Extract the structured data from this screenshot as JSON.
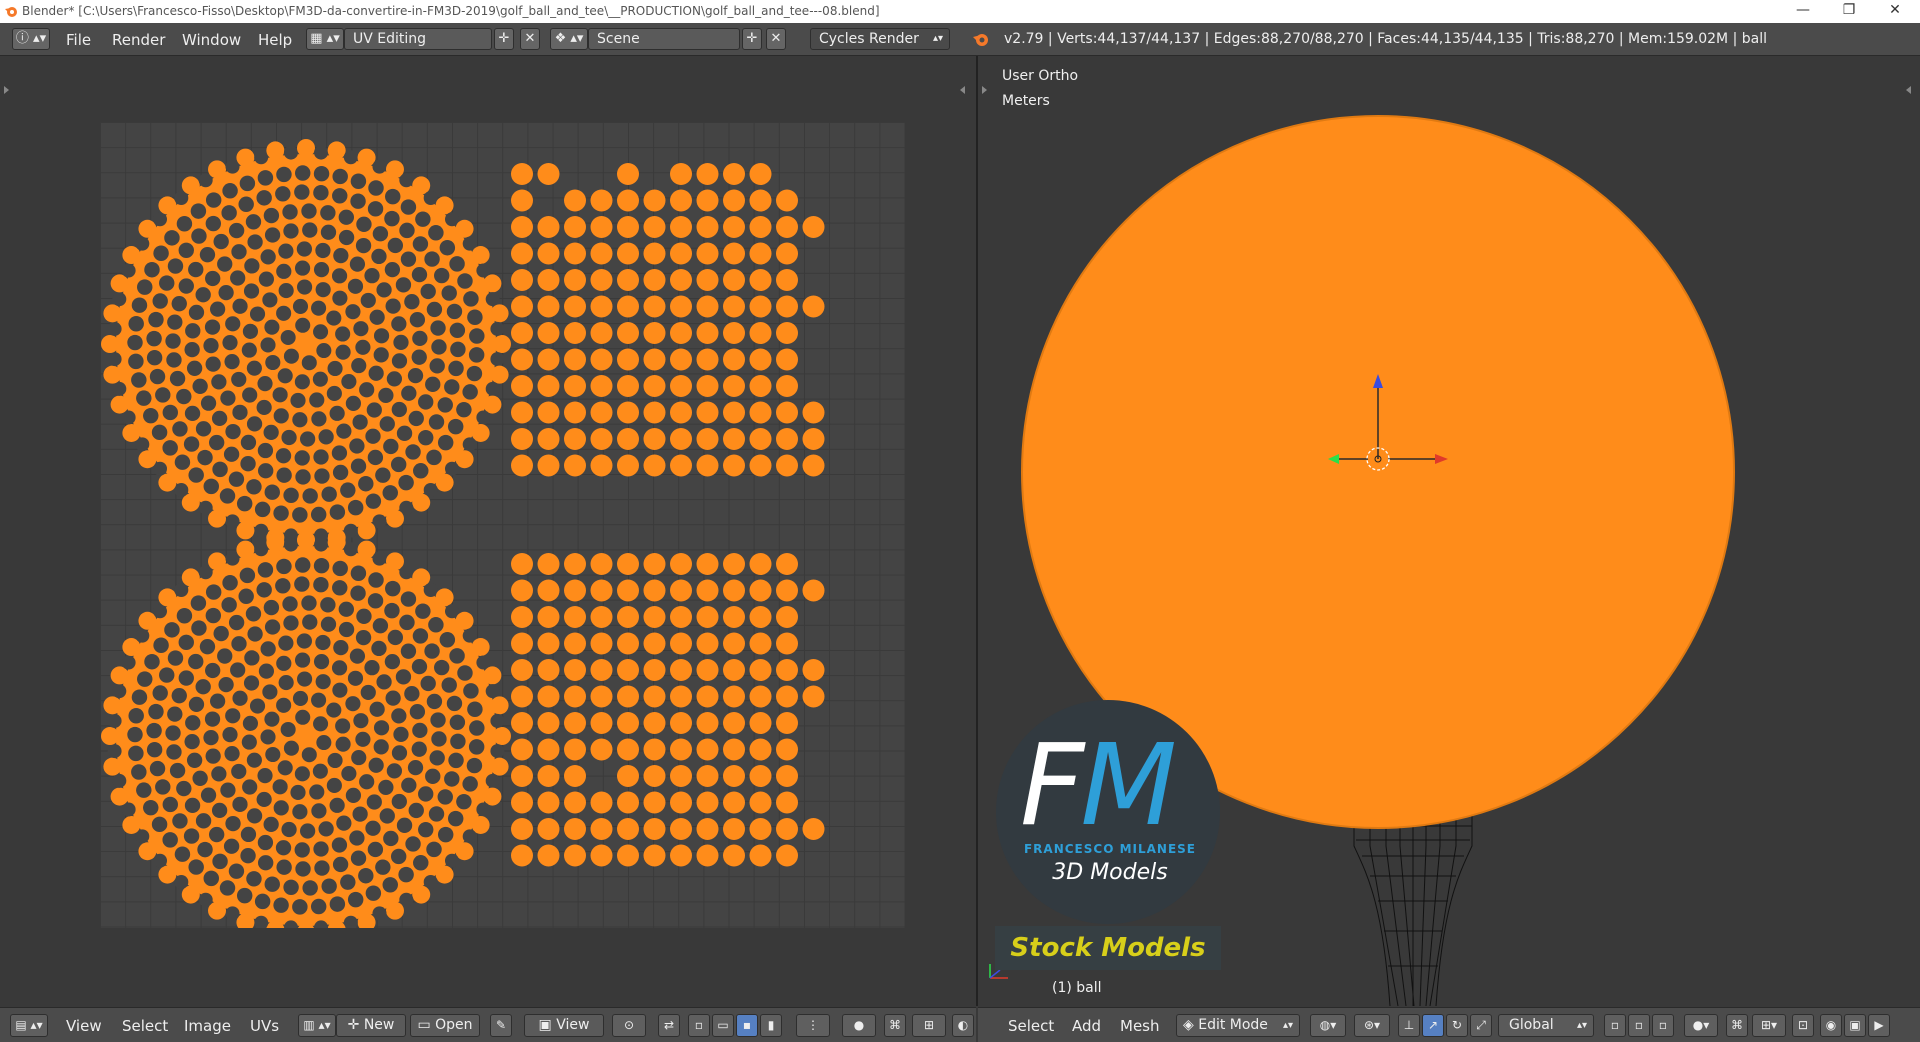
{
  "window": {
    "title": "Blender* [C:\\Users\\Francesco-Fisso\\Desktop\\FM3D-da-convertire-in-FM3D-2019\\golf_ball_and_tee\\__PRODUCTION\\golf_ball_and_tee---08.blend]",
    "minimize": "—",
    "restore": "❐",
    "close": "✕"
  },
  "topbar": {
    "menus": [
      "File",
      "Render",
      "Window",
      "Help"
    ],
    "screen_layout": "UV Editing",
    "scene": "Scene",
    "render_engine": "Cycles Render",
    "stats": "v2.79 | Verts:44,137/44,137 | Edges:88,270/88,270 | Faces:44,135/44,135 | Tris:88,270 | Mem:159.02M | ball"
  },
  "viewport": {
    "view_name": "User Ortho",
    "units": "Meters",
    "object_label": "(1) ball",
    "ball_color": "#ff8c1a"
  },
  "watermark": {
    "f": "F",
    "m": "M",
    "name": "FRANCESCO MILANESE",
    "sub": "3D Models",
    "stock": "Stock Models"
  },
  "uv_footer": {
    "menus": [
      "View",
      "Select",
      "Image",
      "UVs"
    ],
    "new_label": "New",
    "open_label": "Open",
    "view_label": "View"
  },
  "vp_footer": {
    "menus": [
      "Select",
      "Add",
      "Mesh"
    ],
    "mode": "Edit Mode",
    "orientation": "Global"
  },
  "colors": {
    "uv_orange": "#ff8c1a",
    "accent_blue": "#5680c2"
  },
  "icons": [
    "blender-logo-icon",
    "info-icon",
    "screen-layout-icon",
    "scene-icon",
    "add-icon",
    "delete-icon",
    "cursor-icon",
    "transform-gizmo-icon"
  ]
}
